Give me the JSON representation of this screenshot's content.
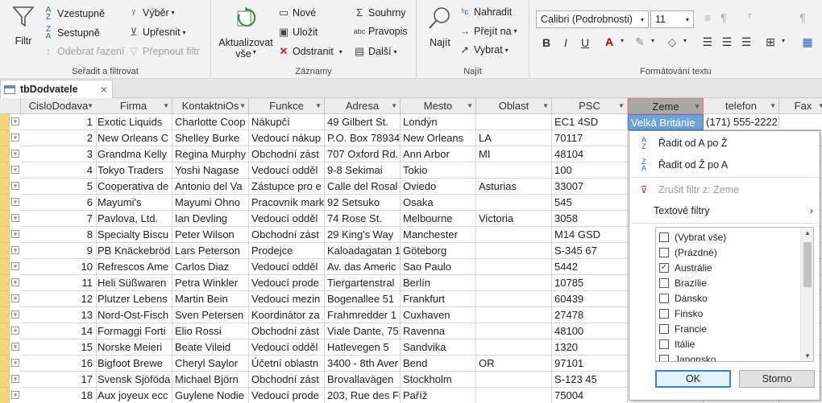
{
  "ribbon": {
    "sort_filter": {
      "filter_label": "Filtr",
      "ascending_label": "Vzestupně",
      "descending_label": "Sestupně",
      "remove_sort_label": "Odebrat řazení",
      "selection_label": "Výběr",
      "advanced_label": "Upřesnit",
      "toggle_filter_label": "Přepnout filtr",
      "group_label": "Seřadit a filtrovat"
    },
    "records": {
      "refresh_label": "Aktualizovat",
      "refresh_sub": "vše",
      "new_label": "Nové",
      "save_label": "Uložit",
      "delete_label": "Odstranit",
      "totals_label": "Souhrny",
      "spelling_label": "Pravopis",
      "more_label": "Další",
      "group_label": "Záznamy"
    },
    "find": {
      "find_label": "Najít",
      "replace_label": "Nahradit",
      "goto_label": "Přejít na",
      "select_label": "Vybrat",
      "group_label": "Najít"
    },
    "text_formatting": {
      "font_name": "Calibri (Podrobnosti)",
      "font_size": "11",
      "bold": "B",
      "italic": "I",
      "underline": "U",
      "group_label": "Formátování textu"
    }
  },
  "document_tab": {
    "title": "tbDodvatele"
  },
  "table": {
    "columns": [
      "CisloDodava",
      "Firma",
      "KontaktniOs",
      "Funkce",
      "Adresa",
      "Mesto",
      "Oblast",
      "PSC",
      "Zeme",
      "telefon",
      "Fax"
    ],
    "rows": [
      [
        "1",
        "Exotic Liquids",
        "Charlotte Coop",
        "Nákupčí",
        "49 Gilbert St.",
        "Londýn",
        "",
        "EC1 4SD",
        "Velká Británie",
        "(171) 555-2222",
        ""
      ],
      [
        "2",
        "New Orleans C",
        "Shelley Burke",
        "Vedoucí nákup",
        "P.O. Box 78934",
        "New Orleans",
        "LA",
        "70117",
        "",
        "",
        ""
      ],
      [
        "3",
        "Grandma Kelly",
        "Regina Murphy",
        "Obchodní zást",
        "707 Oxford Rd.",
        "Ann Arbor",
        "MI",
        "48104",
        "",
        "",
        ""
      ],
      [
        "4",
        "Tokyo Traders",
        "Yoshi Nagase",
        "Vedoucí odděl",
        "9-8 Sekimai",
        "Tokio",
        "",
        "100",
        "",
        "",
        ""
      ],
      [
        "5",
        "Cooperativa de",
        "Antonio del Va",
        "Zástupce pro e",
        "Calle del Rosal",
        "Oviedo",
        "Asturias",
        "33007",
        "",
        "",
        ""
      ],
      [
        "6",
        "Mayumi's",
        "Mayumi Ohno",
        "Pracovník mark",
        "92 Setsuko",
        "Osaka",
        "",
        "545",
        "",
        "",
        ""
      ],
      [
        "7",
        "Pavlova, Ltd.",
        "Ian Devling",
        "Vedoucí odděl",
        "74 Rose St.",
        "Melbourne",
        "Victoria",
        "3058",
        "",
        "",
        ""
      ],
      [
        "8",
        "Specialty Biscu",
        "Peter Wilson",
        "Obchodní zást",
        "29 King's Way",
        "Manchester",
        "",
        "M14 GSD",
        "",
        "",
        ""
      ],
      [
        "9",
        "PB Knäckebröd",
        "Lars Peterson",
        "Prodejce",
        "Kaloadagatan 1",
        "Göteborg",
        "",
        "S-345 67",
        "",
        "",
        ""
      ],
      [
        "10",
        "Refrescos Ame",
        "Carlos Diaz",
        "Vedoucí odděl",
        "Av. das Americ",
        "Sao Paulo",
        "",
        "5442",
        "",
        "",
        ""
      ],
      [
        "11",
        "Heli Süßwaren",
        "Petra Winkler",
        "Vedoucí prode",
        "Tiergartenstral",
        "Berlín",
        "",
        "10785",
        "",
        "",
        ""
      ],
      [
        "12",
        "Plutzer Lebens",
        "Martin Bein",
        "Vedoucí mezin",
        "Bogenallee 51",
        "Frankfurt",
        "",
        "60439",
        "",
        "",
        ""
      ],
      [
        "13",
        "Nord-Ost-Fisch",
        "Sven Petersen",
        "Koordinátor za",
        "Frahmredder 1",
        "Cuxhaven",
        "",
        "27478",
        "",
        "",
        ""
      ],
      [
        "14",
        "Formaggi Forti",
        "Elio Rossi",
        "Obchodní zást",
        "Viale Dante, 75",
        "Ravenna",
        "",
        "48100",
        "",
        "",
        ""
      ],
      [
        "15",
        "Norske Meieri",
        "Beate Vileid",
        "Vedoucí odděl",
        "Hatlevegen 5",
        "Sandvika",
        "",
        "1320",
        "",
        "",
        ""
      ],
      [
        "16",
        "Bigfoot Brewe",
        "Cheryl Saylor",
        "Účetní oblastn",
        "3400 - 8th Aver",
        "Bend",
        "OR",
        "97101",
        "",
        "",
        ""
      ],
      [
        "17",
        "Svensk Sjöföda",
        "Michael Björn",
        "Obchodní zást",
        "Brovallavägen",
        "Stockholm",
        "",
        "S-123 45",
        "",
        "",
        ""
      ],
      [
        "18",
        "Aux joyeux ecc",
        "Guylene Nodie",
        "Vedoucí prode",
        "203, Rue des Fr",
        "Paříž",
        "",
        "75004",
        "",
        "",
        ""
      ]
    ]
  },
  "filter_popup": {
    "sort_asc": "Řadit od A po Ž",
    "sort_desc": "Řadit od Ž po A",
    "clear_filter": "Zrušit filtr z: Zeme",
    "text_filters": "Textové filtry",
    "values": [
      {
        "label": "(Vybrat vše)",
        "checked": false
      },
      {
        "label": "(Prázdné)",
        "checked": false
      },
      {
        "label": "Austrálie",
        "checked": true
      },
      {
        "label": "Brazílie",
        "checked": false
      },
      {
        "label": "Dánsko",
        "checked": false
      },
      {
        "label": "Finsko",
        "checked": false
      },
      {
        "label": "Francie",
        "checked": false
      },
      {
        "label": "Itálie",
        "checked": false
      },
      {
        "label": "Japonsko",
        "checked": false
      }
    ],
    "ok_label": "OK",
    "cancel_label": "Storno"
  },
  "colors": {
    "accent": "#3c7fd6",
    "selector": "#f5d57a",
    "highlight": "#6fa3d8"
  }
}
